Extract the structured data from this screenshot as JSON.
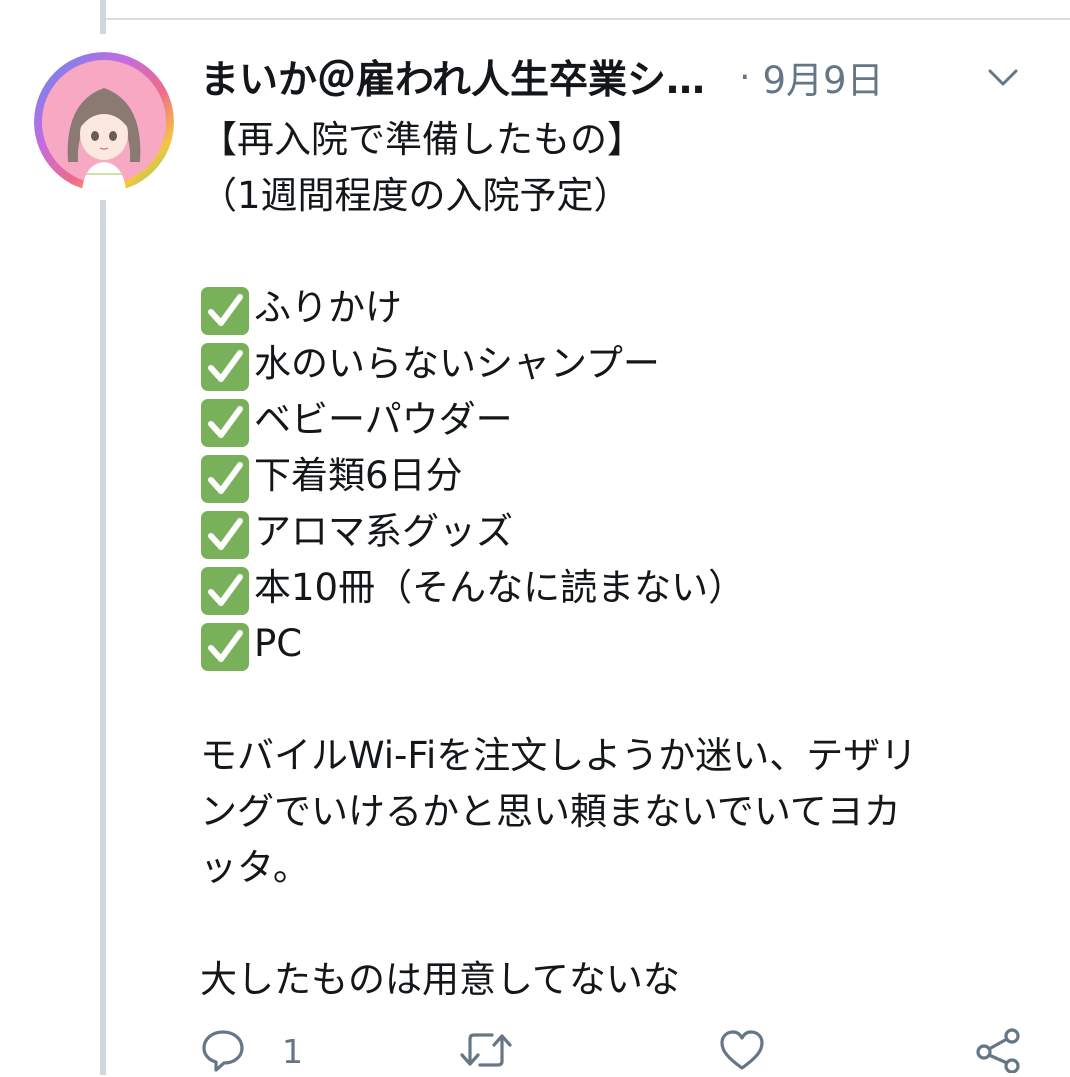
{
  "tweet": {
    "display_name": "まいか＠雇われ人生卒業シ…",
    "separator": "·",
    "timestamp": "9月9日",
    "title_lines": [
      "【再入院で準備したもの】",
      "（1週間程度の入院予定）"
    ],
    "checklist": [
      "ふりかけ",
      "水のいらないシャンプー",
      "ベビーパウダー",
      "下着類6日分",
      "アロマ系グッズ",
      "本10冊（そんなに読まない）",
      "PC"
    ],
    "paragraph_lines": [
      "モバイルWi-Fiを注文しようか迷い、テザリ",
      "ングでいけるかと思い頼まないでいてヨカ",
      "ッタ。"
    ],
    "closing_line": "大したものは用意してないな"
  },
  "actions": {
    "reply_count": "1"
  },
  "icons": {
    "avatar": "avatar",
    "caret": "chevron-down-icon",
    "check": "check-mark-button-icon",
    "reply": "reply-icon",
    "retweet": "retweet-icon",
    "like": "heart-icon",
    "share": "share-icon"
  },
  "colors": {
    "text": "#14171a",
    "secondary_text": "#657786",
    "thread_line": "#d0d8de",
    "check_green": "#78b159"
  }
}
